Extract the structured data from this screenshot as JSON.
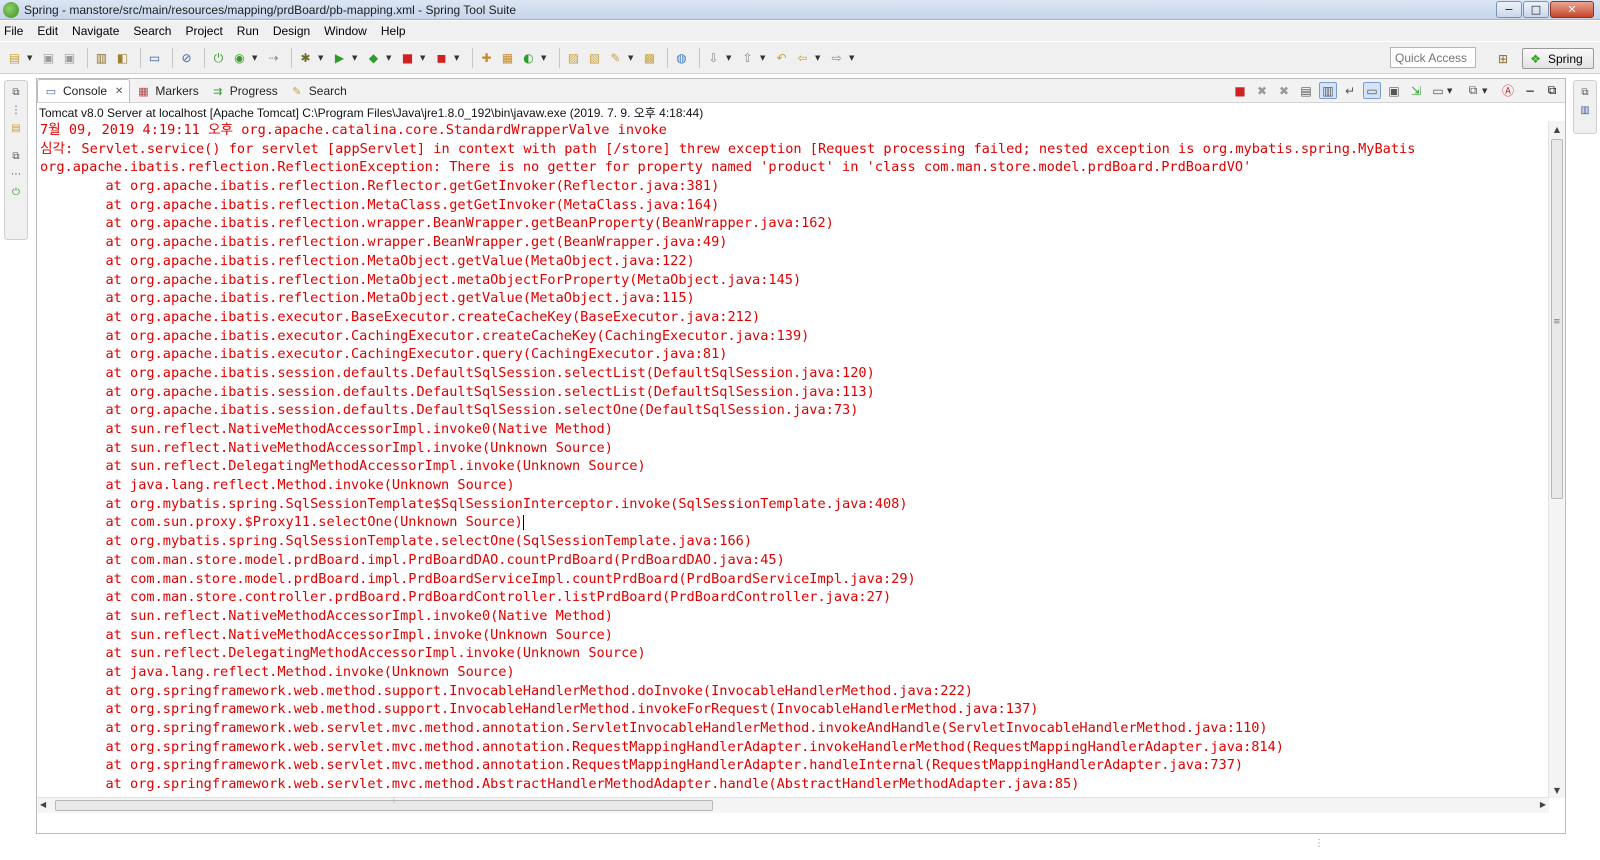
{
  "window": {
    "title": "Spring - manstore/src/main/resources/mapping/prdBoard/pb-mapping.xml - Spring Tool Suite",
    "minimize_label": "−",
    "maximize_label": "□",
    "close_label": "✕"
  },
  "menu": [
    "File",
    "Edit",
    "Navigate",
    "Search",
    "Project",
    "Run",
    "Design",
    "Window",
    "Help"
  ],
  "toolbar": {
    "quick_access_placeholder": "Quick Access",
    "perspective_label": "Spring"
  },
  "console": {
    "tabs": [
      {
        "label": "Console",
        "icon": "console-icon",
        "active": true,
        "closable": true
      },
      {
        "label": "Markers",
        "icon": "markers-icon",
        "active": false
      },
      {
        "label": "Progress",
        "icon": "progress-icon",
        "active": false
      },
      {
        "label": "Search",
        "icon": "search-icon",
        "active": false
      }
    ],
    "process": "Tomcat v8.0 Server at localhost [Apache Tomcat] C:\\Program Files\\Java\\jre1.8.0_192\\bin\\javaw.exe (2019. 7. 9. 오후 4:18:44)",
    "output_color": "#e00000",
    "lines": [
      "7월 09, 2019 4:19:11 오후 org.apache.catalina.core.StandardWrapperValve invoke",
      "심각: Servlet.service() for servlet [appServlet] in context with path [/store] threw exception [Request processing failed; nested exception is org.mybatis.spring.MyBatis",
      "org.apache.ibatis.reflection.ReflectionException: There is no getter for property named 'product' in 'class com.man.store.model.prdBoard.PrdBoardVO'",
      "\tat org.apache.ibatis.reflection.Reflector.getGetInvoker(Reflector.java:381)",
      "\tat org.apache.ibatis.reflection.MetaClass.getGetInvoker(MetaClass.java:164)",
      "\tat org.apache.ibatis.reflection.wrapper.BeanWrapper.getBeanProperty(BeanWrapper.java:162)",
      "\tat org.apache.ibatis.reflection.wrapper.BeanWrapper.get(BeanWrapper.java:49)",
      "\tat org.apache.ibatis.reflection.MetaObject.getValue(MetaObject.java:122)",
      "\tat org.apache.ibatis.reflection.MetaObject.metaObjectForProperty(MetaObject.java:145)",
      "\tat org.apache.ibatis.reflection.MetaObject.getValue(MetaObject.java:115)",
      "\tat org.apache.ibatis.executor.BaseExecutor.createCacheKey(BaseExecutor.java:212)",
      "\tat org.apache.ibatis.executor.CachingExecutor.createCacheKey(CachingExecutor.java:139)",
      "\tat org.apache.ibatis.executor.CachingExecutor.query(CachingExecutor.java:81)",
      "\tat org.apache.ibatis.session.defaults.DefaultSqlSession.selectList(DefaultSqlSession.java:120)",
      "\tat org.apache.ibatis.session.defaults.DefaultSqlSession.selectList(DefaultSqlSession.java:113)",
      "\tat org.apache.ibatis.session.defaults.DefaultSqlSession.selectOne(DefaultSqlSession.java:73)",
      "\tat sun.reflect.NativeMethodAccessorImpl.invoke0(Native Method)",
      "\tat sun.reflect.NativeMethodAccessorImpl.invoke(Unknown Source)",
      "\tat sun.reflect.DelegatingMethodAccessorImpl.invoke(Unknown Source)",
      "\tat java.lang.reflect.Method.invoke(Unknown Source)",
      "\tat org.mybatis.spring.SqlSessionTemplate$SqlSessionInterceptor.invoke(SqlSessionTemplate.java:408)",
      "\tat com.sun.proxy.$Proxy11.selectOne(Unknown Source)",
      "\tat org.mybatis.spring.SqlSessionTemplate.selectOne(SqlSessionTemplate.java:166)",
      "\tat com.man.store.model.prdBoard.impl.PrdBoardDAO.countPrdBoard(PrdBoardDAO.java:45)",
      "\tat com.man.store.model.prdBoard.impl.PrdBoardServiceImpl.countPrdBoard(PrdBoardServiceImpl.java:29)",
      "\tat com.man.store.controller.prdBoard.PrdBoardController.listPrdBoard(PrdBoardController.java:27)",
      "\tat sun.reflect.NativeMethodAccessorImpl.invoke0(Native Method)",
      "\tat sun.reflect.NativeMethodAccessorImpl.invoke(Unknown Source)",
      "\tat sun.reflect.DelegatingMethodAccessorImpl.invoke(Unknown Source)",
      "\tat java.lang.reflect.Method.invoke(Unknown Source)",
      "\tat org.springframework.web.method.support.InvocableHandlerMethod.doInvoke(InvocableHandlerMethod.java:222)",
      "\tat org.springframework.web.method.support.InvocableHandlerMethod.invokeForRequest(InvocableHandlerMethod.java:137)",
      "\tat org.springframework.web.servlet.mvc.method.annotation.ServletInvocableHandlerMethod.invokeAndHandle(ServletInvocableHandlerMethod.java:110)",
      "\tat org.springframework.web.servlet.mvc.method.annotation.RequestMappingHandlerAdapter.invokeHandlerMethod(RequestMappingHandlerAdapter.java:814)",
      "\tat org.springframework.web.servlet.mvc.method.annotation.RequestMappingHandlerAdapter.handleInternal(RequestMappingHandlerAdapter.java:737)",
      "\tat org.springframework.web.servlet.mvc.method.AbstractHandlerMethodAdapter.handle(AbstractHandlerMethodAdapter.java:85)"
    ]
  }
}
